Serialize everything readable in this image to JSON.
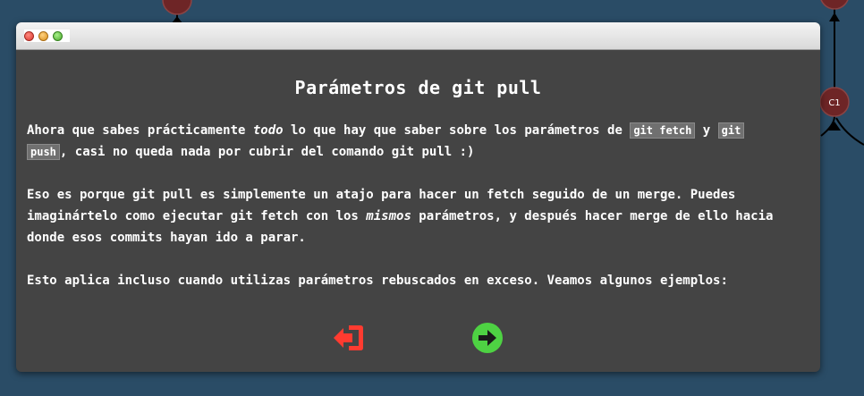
{
  "dialog": {
    "title": "Parámetros de git pull",
    "p1": {
      "t1": "Ahora que sabes prácticamente ",
      "em": "todo",
      "t2": " lo que hay que saber sobre los parámetros de ",
      "code1": "git fetch",
      "t3": " y ",
      "code2a": "git",
      "code2b": "push",
      "t4": ", casi no queda nada por cubrir del comando git pull :)"
    },
    "p2": {
      "t1": "Eso es porque git pull es simplemente un atajo para hacer un fetch seguido de un merge. Puedes imaginártelo como ejecutar git fetch con los ",
      "em": "mismos",
      "t2": " parámetros, y después hacer merge de ello hacia donde esos commits hayan ido a parar."
    },
    "p3": "Esto aplica incluso cuando utilizas parámetros rebuscados en exceso. Veamos algunos ejemplos:"
  },
  "background": {
    "node_c1": "C1"
  },
  "icons": {
    "exit": "sign-out-icon",
    "next": "arrow-circle-right-icon"
  },
  "colors": {
    "background": "#2a4c66",
    "dialog": "#444444",
    "code_bg": "#707070",
    "exit_red": "#ff3b30",
    "next_green": "#4ed243",
    "node": "#6e2526"
  }
}
